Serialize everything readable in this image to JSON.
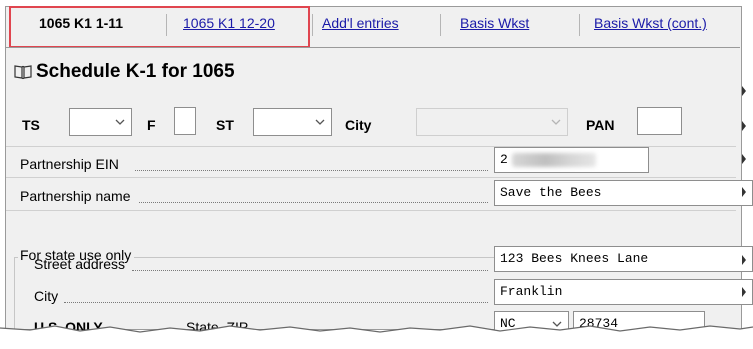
{
  "tabs": [
    {
      "label": "1065 K1  1-11",
      "active": true
    },
    {
      "label": "1065 K1 12-20",
      "active": false
    },
    {
      "label": "Add'l entries",
      "active": false
    },
    {
      "label": "Basis Wkst",
      "active": false
    },
    {
      "label": "Basis Wkst (cont.)",
      "active": false
    }
  ],
  "form": {
    "title": "Schedule K-1 for 1065",
    "title_icon": "book-icon",
    "top_row": {
      "ts_label": "TS",
      "f_label": "F",
      "st_label": "ST",
      "city_label": "City",
      "pan_label": "PAN"
    },
    "partnership_ein": {
      "label": "Partnership EIN",
      "value": "2"
    },
    "partnership_name": {
      "label": "Partnership name",
      "value": "Save the Bees"
    },
    "state_use_group": "For state use only",
    "street_address": {
      "label": "Street address",
      "value": "123 Bees Knees Lane"
    },
    "city": {
      "label": "City",
      "value": "Franklin"
    },
    "us_only_label": "U.S. ONLY",
    "state_zip": {
      "label": "State, ZIP",
      "state_value": "NC",
      "zip_value": "28734"
    }
  },
  "colors": {
    "highlight": "#e0454f",
    "link": "#1a1aa8",
    "panel_bg": "#f0f0f0"
  }
}
